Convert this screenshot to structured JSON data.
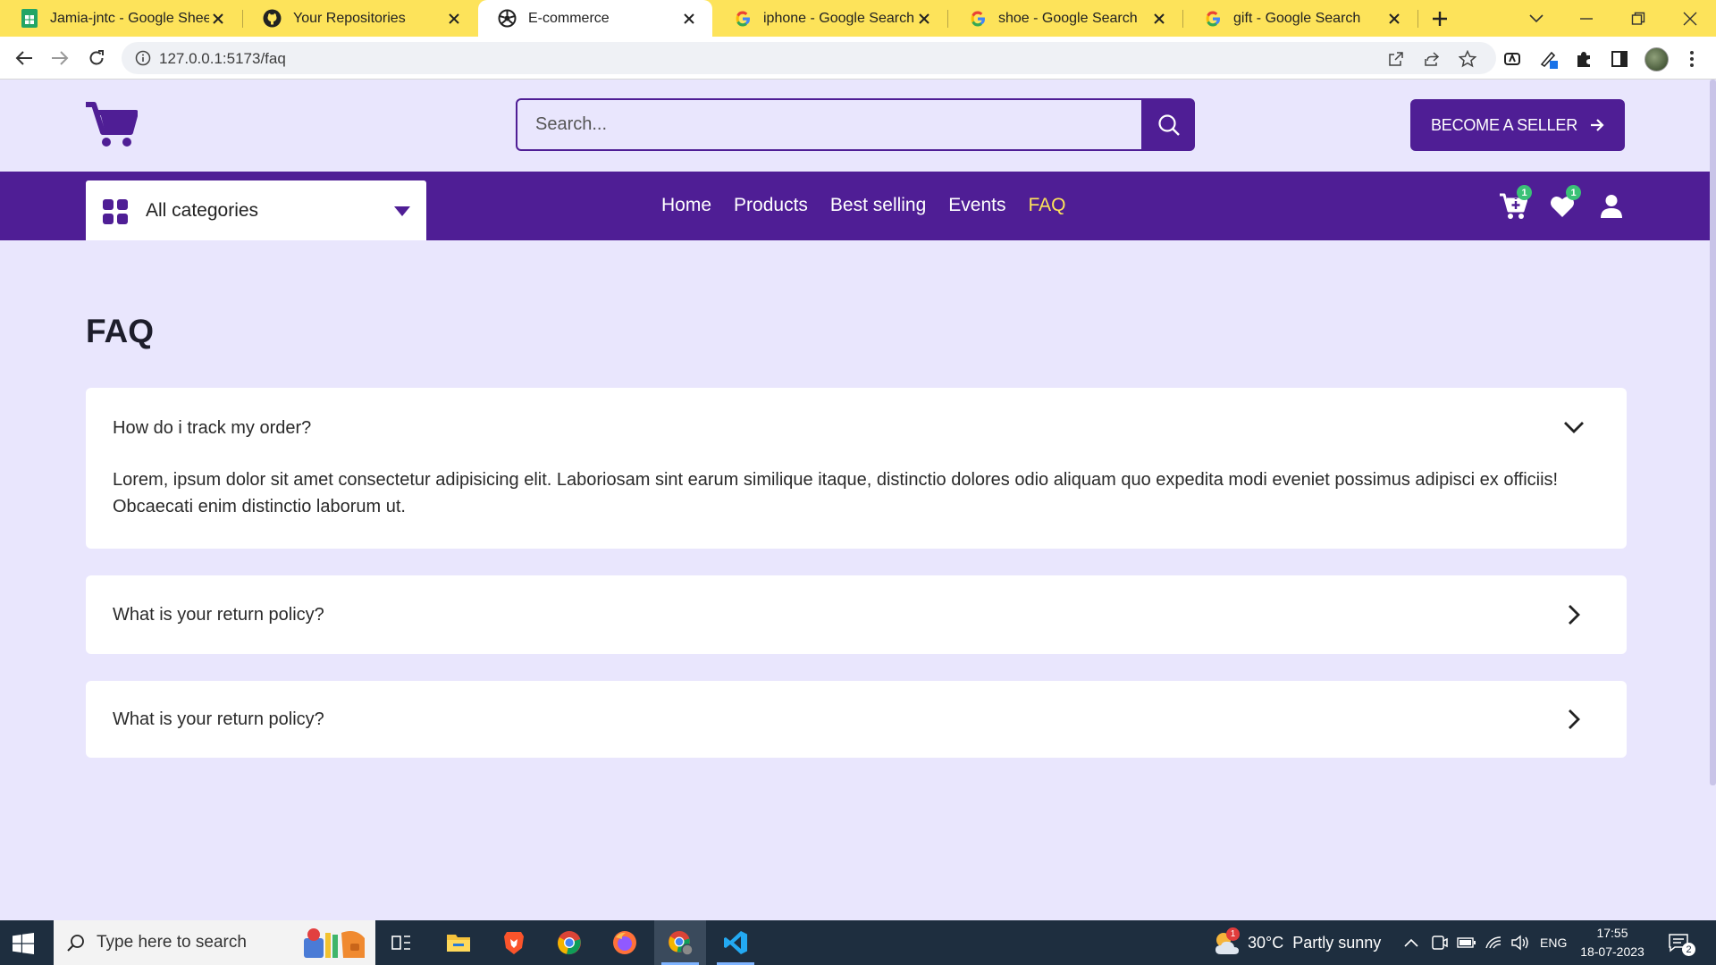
{
  "browser": {
    "tabs": [
      {
        "title": "Jamia-jntc - Google Sheets",
        "icon": "google-sheets-icon"
      },
      {
        "title": "Your Repositories",
        "icon": "github-icon"
      },
      {
        "title": "E-commerce",
        "icon": "site-icon"
      },
      {
        "title": "iphone - Google Search",
        "icon": "google-icon"
      },
      {
        "title": "shoe - Google Search",
        "icon": "google-icon"
      },
      {
        "title": "gift - Google Search",
        "icon": "google-icon"
      }
    ],
    "active_tab_index": 2,
    "url": "127.0.0.1:5173/faq",
    "tab_strip_color": "#fde35a"
  },
  "header": {
    "search_placeholder": "Search...",
    "seller_button_label": "BECOME A SELLER",
    "brand_color": "#4f1e95"
  },
  "nav": {
    "category_label": "All categories",
    "links": [
      "Home",
      "Products",
      "Best selling",
      "Events",
      "FAQ"
    ],
    "active_link": "FAQ",
    "cart_count": "1",
    "wishlist_count": "1"
  },
  "faq": {
    "title": "FAQ",
    "items": [
      {
        "question": "How do i track my order?",
        "answer": "Lorem, ipsum dolor sit amet consectetur adipisicing elit. Laboriosam sint earum similique itaque, distinctio dolores odio aliquam quo expedita modi eveniet possimus adipisci ex officiis! Obcaecati enim distinctio laborum ut.",
        "expanded": true
      },
      {
        "question": "What is your return policy?",
        "expanded": false
      },
      {
        "question": "What is your return policy?",
        "expanded": false
      }
    ]
  },
  "taskbar": {
    "search_placeholder": "Type here to search",
    "weather": "30°C  Partly sunny",
    "weather_alert_count": "1",
    "language": "ENG",
    "time": "17:55",
    "date": "18-07-2023",
    "notification_count": "2"
  }
}
